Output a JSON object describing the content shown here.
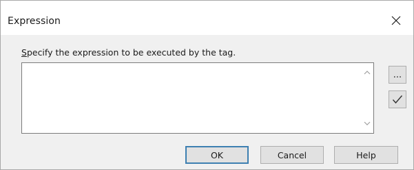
{
  "dialog": {
    "title": "Expression",
    "close_icon": "close-icon"
  },
  "prompt": {
    "accelerator": "S",
    "rest": "pecify the expression to be executed by the tag."
  },
  "expression_field": {
    "value": ""
  },
  "side_buttons": {
    "browse_label": "...",
    "check_icon": "check-icon"
  },
  "footer": {
    "ok_label": "OK",
    "cancel_label": "Cancel",
    "help_label": "Help"
  },
  "colors": {
    "default_button_border": "#3c7fb1",
    "button_face": "#e1e1e1",
    "dialog_background": "#f0f0f0"
  }
}
